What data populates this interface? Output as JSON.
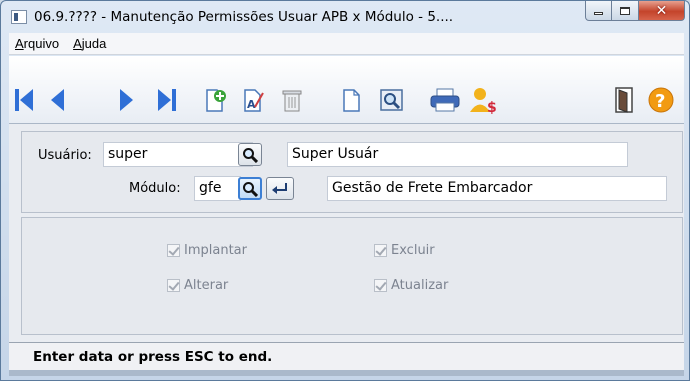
{
  "window": {
    "title": "06.9.???? - Manutenção Permissões Usuar APB x Módulo - 5...."
  },
  "menu": {
    "items": [
      {
        "first": "A",
        "rest": "rquivo"
      },
      {
        "first": "A",
        "rest": "juda"
      }
    ]
  },
  "toolbar": {
    "icons": [
      "first-record-icon",
      "previous-record-icon",
      "next-record-icon",
      "last-record-icon",
      "new-record-icon",
      "edit-record-icon",
      "delete-record-icon",
      "blank-document-icon",
      "zoom-search-icon",
      "print-icon",
      "users-money-icon",
      "exit-door-icon",
      "help-icon"
    ]
  },
  "form": {
    "usuario_label": "Usuário:",
    "usuario_value": "super",
    "usuario_desc": "Super Usuár",
    "modulo_label": "Módulo:",
    "modulo_value": "gfe",
    "modulo_desc": "Gestão de Frete Embarcador"
  },
  "permissions": {
    "implantar": {
      "label": "Implantar",
      "checked": true
    },
    "excluir": {
      "label": "Excluir",
      "checked": true
    },
    "alterar": {
      "label": "Alterar",
      "checked": true
    },
    "atualizar": {
      "label": "Atualizar",
      "checked": true
    }
  },
  "status": {
    "text": "Enter data or press ESC to end."
  },
  "colors": {
    "nav_blue": "#2f6fd6",
    "help_orange": "#f29b12",
    "close_red": "#c4442b"
  }
}
